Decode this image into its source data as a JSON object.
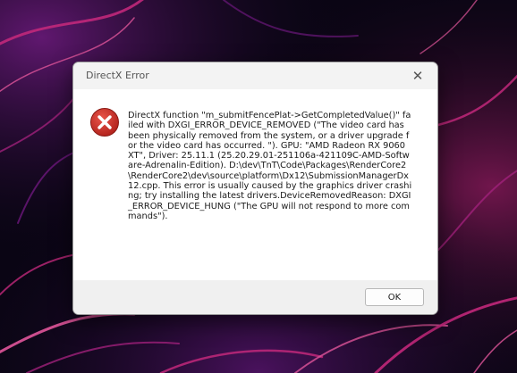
{
  "dialog": {
    "title": "DirectX Error",
    "close_glyph": "✕",
    "icon": "error-icon",
    "message": "DirectX function \"m_submitFencePlat->GetCompletedValue()\" failed with DXGI_ERROR_DEVICE_REMOVED (\"The video card has been physically removed from the system, or a driver upgrade for the video card has occurred. \"). GPU: \"AMD Radeon RX 9060 XT\", Driver: 25.11.1 (25.20.29.01-251106a-421109C-AMD-Software-Adrenalin-Edition). D:\\dev\\TnT\\Code\\Packages\\RenderCore2\\RenderCore2\\dev\\source\\platform\\Dx12\\SubmissionManagerDx12.cpp. This error is usually caused by the graphics driver crashing; try installing the latest drivers.DeviceRemovedReason: DXGI_ERROR_DEVICE_HUNG (\"The GPU will not respond to more commands\").",
    "ok_label": "OK"
  },
  "colors": {
    "error_red": "#c42b1c",
    "titlebar": "#f3f3f3",
    "footer": "#f0f0f0",
    "wallpaper_base": "#0a0514",
    "wallpaper_accent": "#c1287a"
  }
}
